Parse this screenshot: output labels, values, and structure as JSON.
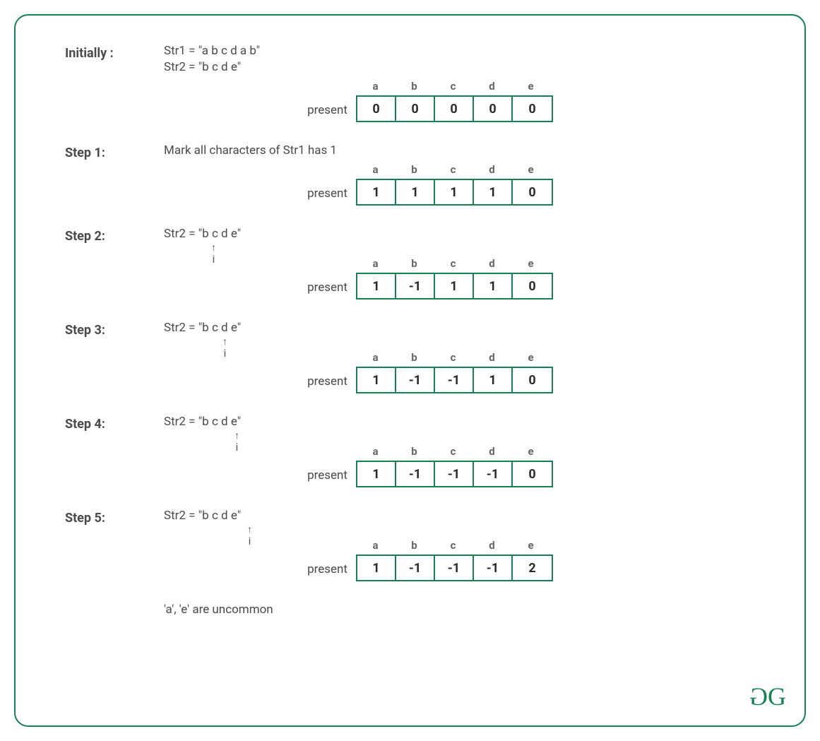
{
  "initially": {
    "label": "Initially :",
    "str1": "Str1 = \"a b c d a b\"",
    "str2": "Str2 = \"b c d e\"",
    "presentLabel": "present",
    "headers": [
      "a",
      "b",
      "c",
      "d",
      "e"
    ],
    "values": [
      "0",
      "0",
      "0",
      "0",
      "0"
    ]
  },
  "step1": {
    "label": "Step 1:",
    "text": "Mark all characters of Str1 has 1",
    "presentLabel": "present",
    "headers": [
      "a",
      "b",
      "c",
      "d",
      "e"
    ],
    "values": [
      "1",
      "1",
      "1",
      "1",
      "0"
    ]
  },
  "step2": {
    "label": "Step 2:",
    "str2": "Str2 = \"b c d e\"",
    "iLabel": "i",
    "pointerLeft": "67px",
    "presentLabel": "present",
    "headers": [
      "a",
      "b",
      "c",
      "d",
      "e"
    ],
    "values": [
      "1",
      "-1",
      "1",
      "1",
      "0"
    ]
  },
  "step3": {
    "label": "Step 3:",
    "str2": "Str2 = \"b c d e\"",
    "iLabel": "i",
    "pointerLeft": "83px",
    "presentLabel": "present",
    "headers": [
      "a",
      "b",
      "c",
      "d",
      "e"
    ],
    "values": [
      "1",
      "-1",
      "-1",
      "1",
      "0"
    ]
  },
  "step4": {
    "label": "Step 4:",
    "str2": "Str2 = \"b c d e\"",
    "iLabel": "i",
    "pointerLeft": "100px",
    "presentLabel": "present",
    "headers": [
      "a",
      "b",
      "c",
      "d",
      "e"
    ],
    "values": [
      "1",
      "-1",
      "-1",
      "-1",
      "0"
    ]
  },
  "step5": {
    "label": "Step 5:",
    "str2": "Str2 = \"b c d e\"",
    "iLabel": "i",
    "pointerLeft": "118px",
    "presentLabel": "present",
    "headers": [
      "a",
      "b",
      "c",
      "d",
      "e"
    ],
    "values": [
      "1",
      "-1",
      "-1",
      "-1",
      "2"
    ]
  },
  "conclusion": "'a', 'e' are uncommon",
  "logo": {
    "g1": "G",
    "g2": "G"
  }
}
